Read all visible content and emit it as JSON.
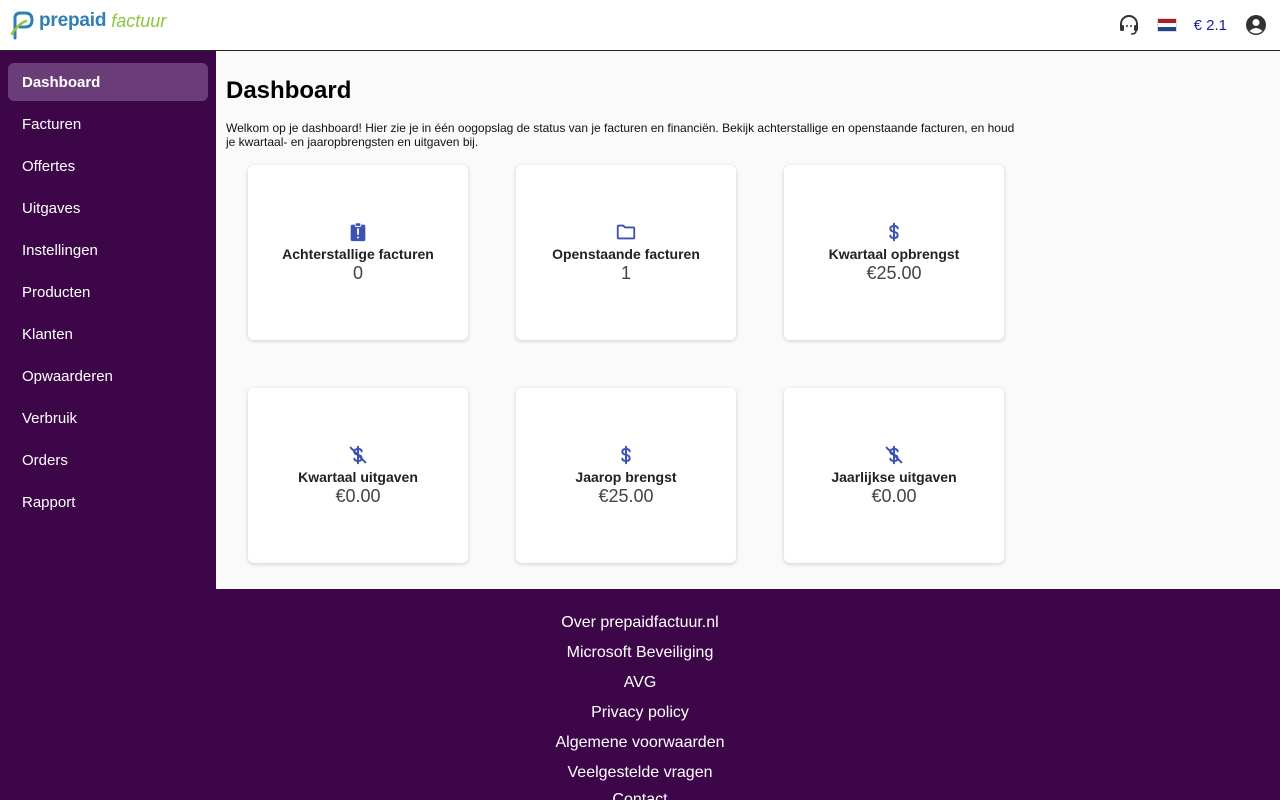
{
  "header": {
    "logo_primary": "prepaid",
    "logo_secondary": "factuur",
    "balance": "€ 2.1",
    "support_icon": "headset-icon",
    "flag_icon": "netherlands-flag-icon",
    "account_icon": "account-circle-icon"
  },
  "sidebar": {
    "items": [
      {
        "label": "Dashboard",
        "active": true
      },
      {
        "label": "Facturen"
      },
      {
        "label": "Offertes"
      },
      {
        "label": "Uitgaves"
      },
      {
        "label": "Instellingen"
      },
      {
        "label": "Producten"
      },
      {
        "label": "Klanten"
      },
      {
        "label": "Opwaarderen"
      },
      {
        "label": "Verbruik"
      },
      {
        "label": "Orders"
      },
      {
        "label": "Rapport"
      }
    ]
  },
  "main": {
    "title": "Dashboard",
    "intro": "Welkom op je dashboard! Hier zie je in één oogopslag de status van je facturen en financiën. Bekijk achterstallige en openstaande facturen, en houd je kwartaal- en jaaropbrengsten en uitgaven bij.",
    "cards": [
      {
        "icon": "clipboard-alert-icon",
        "label": "Achterstallige facturen",
        "value": "0"
      },
      {
        "icon": "folder-icon",
        "label": "Openstaande facturen",
        "value": "1"
      },
      {
        "icon": "dollar-icon",
        "label": "Kwartaal opbrengst",
        "value": "€25.00"
      },
      {
        "icon": "dollar-off-icon",
        "label": "Kwartaal uitgaven",
        "value": "€0.00"
      },
      {
        "icon": "dollar-icon",
        "label": "Jaarop brengst",
        "value": "€25.00"
      },
      {
        "icon": "dollar-off-icon",
        "label": "Jaarlijkse uitgaven",
        "value": "€0.00"
      }
    ]
  },
  "footer": {
    "links": [
      "Over prepaidfactuur.nl",
      "Microsoft Beveiliging",
      "AVG",
      "Privacy policy",
      "Algemene voorwaarden",
      "Veelgestelde vragen",
      "Contact"
    ]
  },
  "colors": {
    "sidebar_bg": "#3d0648",
    "sidebar_active": "#6b3d78",
    "icon_blue": "#3f51b5",
    "balance_blue": "#1a1aa6"
  }
}
